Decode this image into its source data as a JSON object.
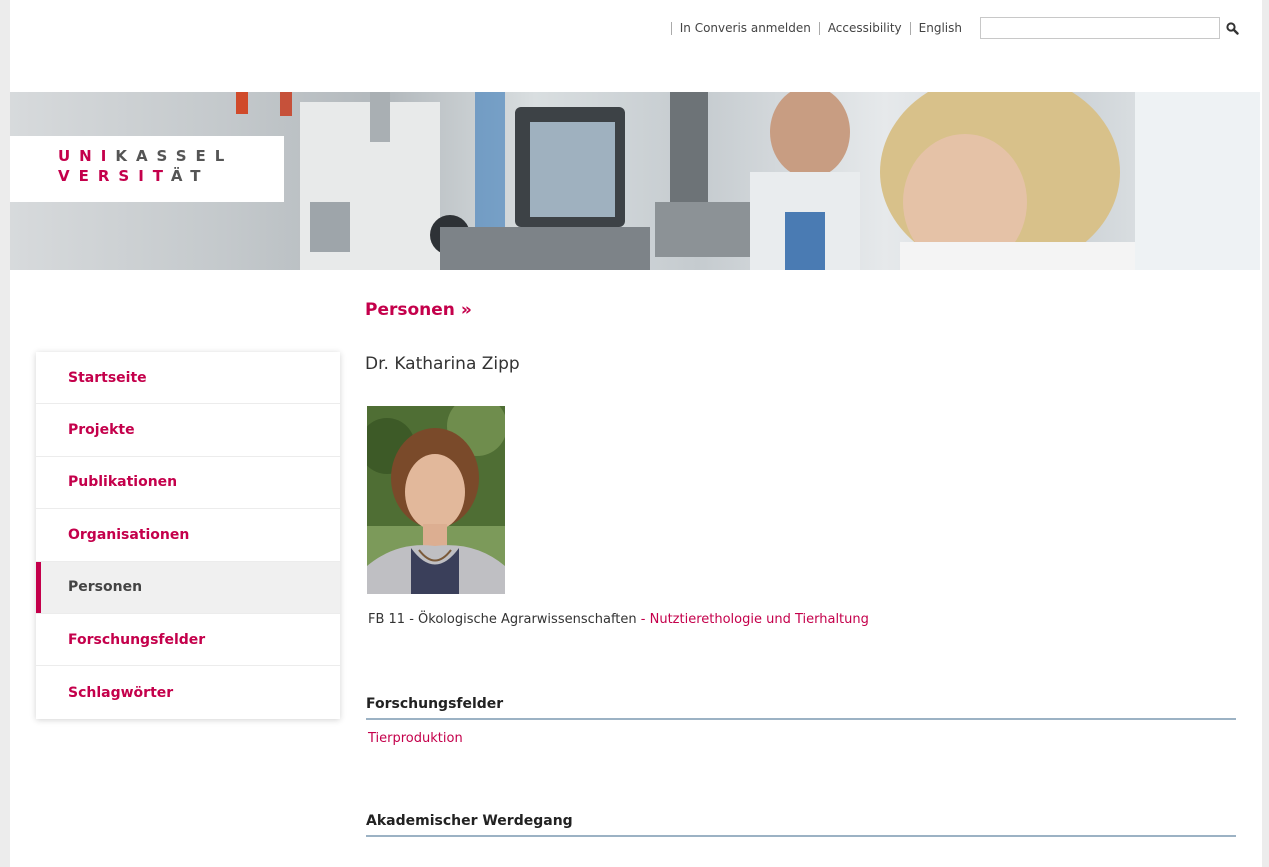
{
  "topbar": {
    "links": [
      "In Converis anmelden",
      "Accessibility",
      "English"
    ],
    "search_value": ""
  },
  "logo": {
    "row1_red": "UNI",
    "row1_gray": "KASSEL",
    "row2_red": "VERSIT",
    "row2_gray": "ÄT"
  },
  "sidebar": {
    "items": [
      {
        "label": "Startseite"
      },
      {
        "label": "Projekte"
      },
      {
        "label": "Publikationen"
      },
      {
        "label": "Organisationen"
      },
      {
        "label": "Personen",
        "active": true
      },
      {
        "label": "Forschungsfelder"
      },
      {
        "label": "Schlagwörter"
      }
    ]
  },
  "main": {
    "breadcrumb": "Personen »",
    "person_name": "Dr. Katharina Zipp",
    "affiliation_text": "FB 11 - Ökologische Agrarwissenschaften",
    "affiliation_sep": " - ",
    "affiliation_link": "Nutztierethologie und Tierhaltung",
    "sections": {
      "forschungsfelder": {
        "title": "Forschungsfelder",
        "items": [
          "Tierproduktion"
        ]
      },
      "werdegang": {
        "title": "Akademischer Werdegang"
      }
    }
  },
  "colors": {
    "accent": "#c4004b",
    "rule": "#9cb2c4"
  }
}
